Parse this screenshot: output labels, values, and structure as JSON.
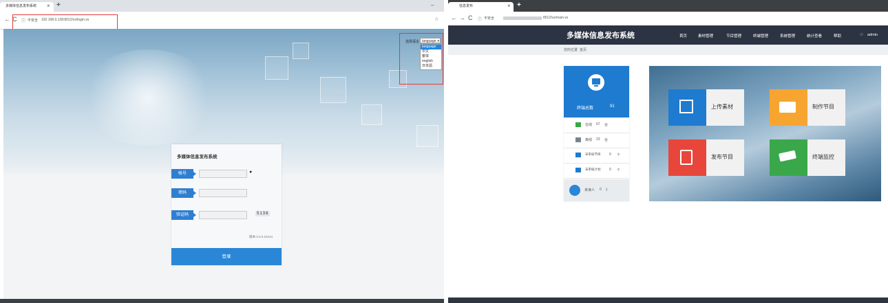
{
  "left_window": {
    "tab_title": "多媒体信息发布系统",
    "tab_close": "×",
    "new_tab": "+",
    "address_security": "不安全",
    "address_url": "192.168.0.128:8012/vs/login.vs",
    "lang_label": "选择语言",
    "lang_selected": "language",
    "lang_options": [
      "language",
      "中文",
      "繁体",
      "english",
      "日本語"
    ],
    "login": {
      "title": "多媒体信息发布系统",
      "fields": [
        "帐号",
        "密码",
        "验证码"
      ],
      "captcha": "5138",
      "version": "版本:3.3.0.15124",
      "button": "登录"
    }
  },
  "right_window": {
    "tab_title": "信息发布",
    "tab_close": "×",
    "new_tab": "+",
    "address_security": "不安全",
    "address_url": "8012/vs/main.vs",
    "system_title": "多媒体信息发布系统",
    "nav": [
      "首页",
      "素材管理",
      "节目管理",
      "终端管理",
      "系统管理",
      "统计查看",
      "帮助"
    ],
    "user": "admin",
    "breadcrumb": [
      "您的位置",
      "首页"
    ],
    "terminals": {
      "head_label": "终端总数",
      "head_value": "91",
      "online_label": "在线",
      "online_value": "67",
      "online_unit": "台",
      "offline_label": "离线",
      "offline_value": "23",
      "offline_unit": "台",
      "pending_program_label": "未审核节目",
      "pending_program_value": "0",
      "pending_program_unit": "个",
      "pending_plan_label": "未审核计划",
      "pending_plan_value": "0",
      "pending_plan_unit": "个",
      "foot_label": "未读人",
      "foot_value": "0",
      "foot_more": "》"
    },
    "cards": [
      {
        "label": "上传素材",
        "color": "#1e7bd0"
      },
      {
        "label": "制作节目",
        "color": "#f7a531"
      },
      {
        "label": "发布节目",
        "color": "#e8463b"
      },
      {
        "label": "终端监控",
        "color": "#3aa84a"
      }
    ]
  }
}
